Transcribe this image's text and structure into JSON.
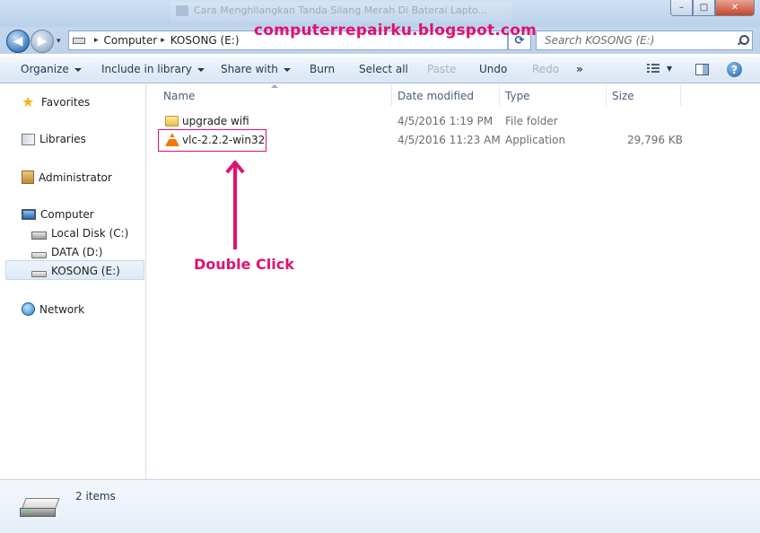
{
  "window": {
    "title": "Cara Menghilangkan Tanda Silang Merah Di Baterai Lapto...",
    "minimize_glyph": "–",
    "maximize_glyph": "□",
    "close_glyph": "✕"
  },
  "watermark": "computerrepairku.blogspot.com",
  "nav": {
    "back_glyph": "◀",
    "forward_glyph": "▶",
    "dropdown_glyph": "▾",
    "refresh_glyph": "⟳"
  },
  "address": {
    "segments": [
      "Computer",
      "KOSONG (E:)"
    ],
    "separator": "▸"
  },
  "search": {
    "placeholder": "Search KOSONG (E:)"
  },
  "toolbar": {
    "organize": "Organize",
    "include_in_library": "Include in library",
    "share_with": "Share with",
    "burn": "Burn",
    "select_all": "Select all",
    "paste": "Paste",
    "undo": "Undo",
    "redo": "Redo",
    "more": "»",
    "views_caret": "▾",
    "help": "?"
  },
  "sidebar": {
    "items": [
      {
        "label": "Favorites",
        "icon": "star-icon"
      },
      {
        "label": "Libraries",
        "icon": "libraries-icon"
      },
      {
        "label": "Administrator",
        "icon": "user-folder-icon"
      },
      {
        "label": "Computer",
        "icon": "computer-icon"
      },
      {
        "label": "Local Disk (C:)",
        "icon": "local-disk-icon"
      },
      {
        "label": "DATA (D:)",
        "icon": "drive-icon"
      },
      {
        "label": "KOSONG (E:)",
        "icon": "drive-icon",
        "selected": true
      },
      {
        "label": "Network",
        "icon": "network-icon"
      }
    ]
  },
  "columns": {
    "name": "Name",
    "date_modified": "Date modified",
    "type": "Type",
    "size": "Size"
  },
  "files": [
    {
      "name": "upgrade wifi",
      "date": "4/5/2016 1:19 PM",
      "type": "File folder",
      "size": "",
      "icon": "folder-icon"
    },
    {
      "name": "vlc-2.2.2-win32",
      "date": "4/5/2016 11:23 AM",
      "type": "Application",
      "size": "29,796 KB",
      "icon": "vlc-icon"
    }
  ],
  "annotation": "Double Click",
  "details": {
    "item_count": "2 items"
  },
  "colors": {
    "annotation": "#e0116f",
    "accent": "#1e3957"
  }
}
